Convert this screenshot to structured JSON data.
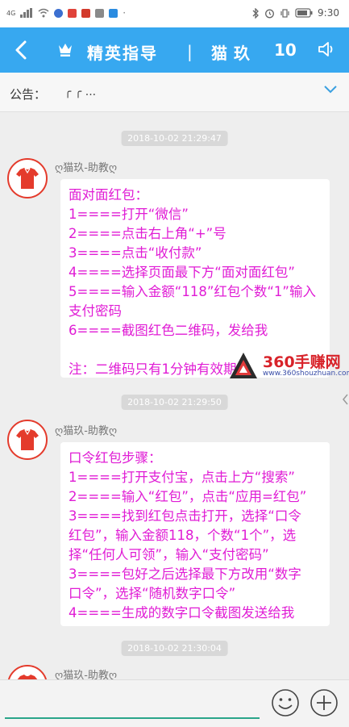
{
  "status": {
    "network": "4G",
    "time": "9:30"
  },
  "header": {
    "title": "精英指导",
    "divider": "|",
    "user_name": "猫玖",
    "count": "10"
  },
  "notice": {
    "label": "公告：",
    "text": "╭ ╭ ..."
  },
  "messages": [
    {
      "timestamp": "2018-10-02 21:29:47",
      "sender": "ღ猫玖-助教ღ",
      "lines": [
        "面对面红包：",
        "1====打开“微信”",
        "2====点击右上角“+”号",
        "3====点击“收付款”",
        "4====选择页面最下方“面对面红包”",
        "5====输入金额“118”红包个数“1”输入",
        "支付密码",
        "6====截图红色二维码，发给我",
        "",
        "注：二维码只有1分钟有效期"
      ]
    },
    {
      "timestamp": "2018-10-02 21:29:50",
      "sender": "ღ猫玖-助教ღ",
      "lines": [
        "口令红包步骤：",
        "1====打开支付宝，点击上方“搜索”",
        "2====输入“红包”，点击“应用=红包”",
        "3====找到红包点击打开，选择“口令",
        "红包”，输入金额118，个数“1个”，选",
        "择“任何人可领”，输入“支付密码”",
        "3====包好之后选择最下方改用“数字",
        "口令”，选择“随机数字口令”",
        "4====生成的数字口令截图发送给我"
      ]
    },
    {
      "timestamp": "2018-10-02 21:30:04",
      "sender": "ღ猫玖-助教ღ",
      "lines": []
    }
  ],
  "watermark": {
    "brand": "360手赚网",
    "url": "www.360shouzhuan.com"
  },
  "colors": {
    "header_bg": "#37a8f0",
    "message_text": "#e01cd5",
    "input_line": "#2aa58a"
  }
}
